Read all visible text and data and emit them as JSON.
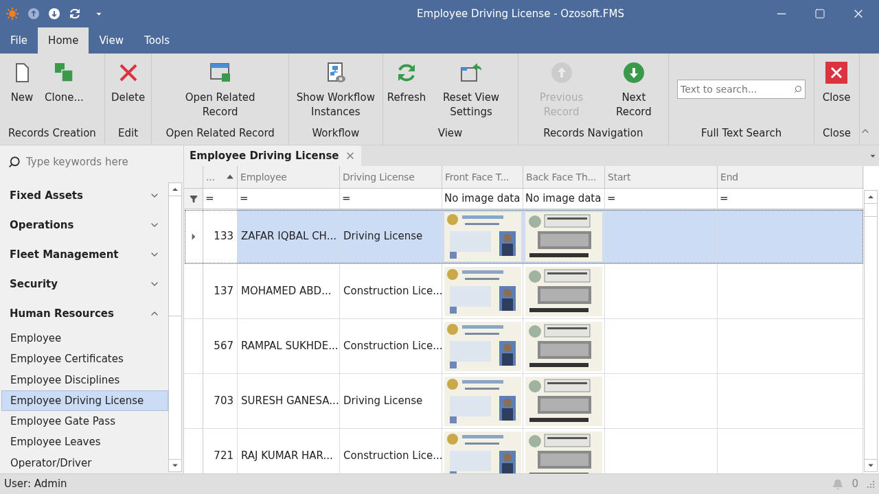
{
  "window": {
    "title": "Employee Driving License - Ozosoft.FMS"
  },
  "menu_tabs": [
    {
      "label": "File",
      "selected": false
    },
    {
      "label": "Home",
      "selected": true
    },
    {
      "label": "View",
      "selected": false
    },
    {
      "label": "Tools",
      "selected": false
    }
  ],
  "ribbon": {
    "groups": [
      {
        "label": "Records Creation",
        "items": [
          {
            "kind": "button",
            "label": "New",
            "disabled": false
          },
          {
            "kind": "button",
            "label": "Clone...",
            "disabled": false
          }
        ]
      },
      {
        "label": "Edit",
        "items": [
          {
            "kind": "button",
            "label": "Delete",
            "disabled": false
          }
        ]
      },
      {
        "label": "Open Related Record",
        "items": [
          {
            "kind": "button",
            "label": "Open Related Record",
            "disabled": false
          }
        ]
      },
      {
        "label": "Workflow",
        "items": [
          {
            "kind": "button",
            "label": "Show Workflow Instances",
            "disabled": false
          }
        ]
      },
      {
        "label": "View",
        "items": [
          {
            "kind": "button",
            "label": "Refresh",
            "disabled": false
          },
          {
            "kind": "button",
            "label": "Reset View Settings",
            "disabled": false
          }
        ]
      },
      {
        "label": "Records Navigation",
        "items": [
          {
            "kind": "button",
            "label": "Previous Record",
            "disabled": true
          },
          {
            "kind": "button",
            "label": "Next Record",
            "disabled": false
          }
        ]
      },
      {
        "label": "Full Text Search",
        "items": [
          {
            "kind": "search",
            "placeholder": "Text to search..."
          }
        ]
      },
      {
        "label": "Close",
        "items": [
          {
            "kind": "button",
            "label": "Close",
            "disabled": false
          }
        ]
      }
    ]
  },
  "sidebar": {
    "search": {
      "placeholder": "Type keywords here"
    },
    "groups": [
      {
        "label": "Fixed Assets",
        "expanded": false
      },
      {
        "label": "Operations",
        "expanded": false
      },
      {
        "label": "Fleet Management",
        "expanded": false
      },
      {
        "label": "Security",
        "expanded": false
      },
      {
        "label": "Human Resources",
        "expanded": true,
        "children": [
          {
            "label": "Employee",
            "selected": false
          },
          {
            "label": "Employee Certificates",
            "selected": false
          },
          {
            "label": "Employee Disciplines",
            "selected": false
          },
          {
            "label": "Employee Driving License",
            "selected": true
          },
          {
            "label": "Employee Gate Pass",
            "selected": false
          },
          {
            "label": "Employee Leaves",
            "selected": false
          },
          {
            "label": "Operator/Driver",
            "selected": false
          }
        ]
      }
    ]
  },
  "document_tab": {
    "title": "Employee Driving License"
  },
  "table": {
    "columns": [
      {
        "label": "...",
        "sorted": true
      },
      {
        "label": "Employee",
        "sorted": false
      },
      {
        "label": "Driving License",
        "sorted": false
      },
      {
        "label": "Front Face T...",
        "sorted": false
      },
      {
        "label": "Back Face Th...",
        "sorted": false
      },
      {
        "label": "Start",
        "sorted": false
      },
      {
        "label": "End",
        "sorted": false
      }
    ],
    "filter_row": [
      "=",
      "=",
      "=",
      "No image data",
      "No image data",
      "=",
      "="
    ],
    "rows": [
      {
        "id": "133",
        "employee": "ZAFAR IQBAL CH...",
        "license": "Driving License",
        "selected": true
      },
      {
        "id": "137",
        "employee": "MOHAMED ABD...",
        "license": "Construction Lice...",
        "selected": false
      },
      {
        "id": "567",
        "employee": "RAMPAL SUKHDE...",
        "license": "Construction Lice...",
        "selected": false
      },
      {
        "id": "703",
        "employee": "SURESH GANESA...",
        "license": "Driving License",
        "selected": false
      },
      {
        "id": "721",
        "employee": "RAJ KUMAR HAR...",
        "license": "Construction Lice...",
        "selected": false
      }
    ]
  },
  "status_bar": {
    "user": "User: Admin",
    "notifications": "0"
  }
}
